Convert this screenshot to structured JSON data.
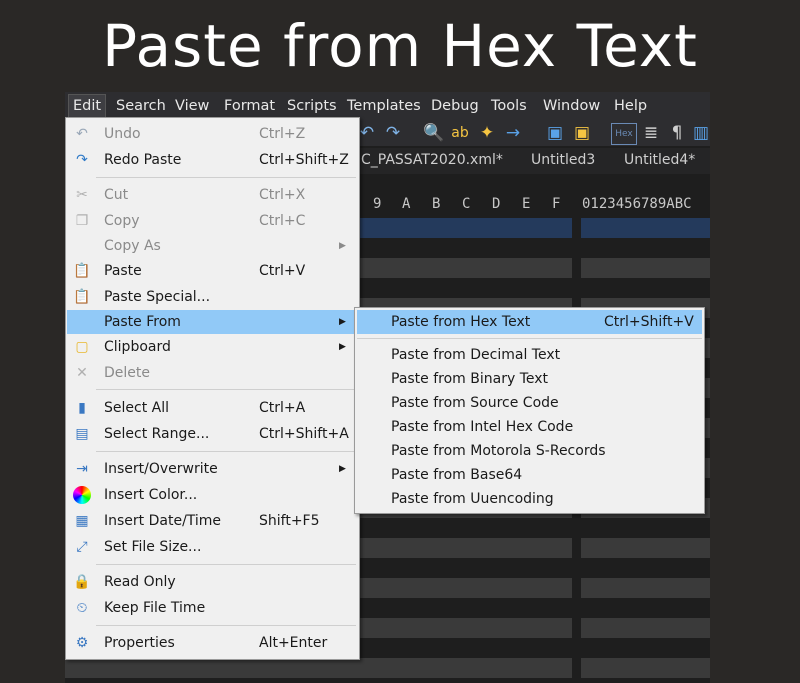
{
  "big_title": "Paste from Hex Text",
  "menubar": [
    "Edit",
    "Search",
    "View",
    "Format",
    "Scripts",
    "Templates",
    "Debug",
    "Tools",
    "Window",
    "Help"
  ],
  "tabs": [
    "C_PASSAT2020.xml*",
    "Untitled3",
    "Untitled4*"
  ],
  "hex_header": {
    "cols": [
      "9",
      "A",
      "B",
      "C",
      "D",
      "E",
      "F"
    ],
    "ascii": "0123456789ABC"
  },
  "edit_menu": {
    "undo": {
      "label": "Undo",
      "shortcut": "Ctrl+Z"
    },
    "redo": {
      "label": "Redo Paste",
      "shortcut": "Ctrl+Shift+Z"
    },
    "cut": {
      "label": "Cut",
      "shortcut": "Ctrl+X"
    },
    "copy": {
      "label": "Copy",
      "shortcut": "Ctrl+C"
    },
    "copy_as": {
      "label": "Copy As"
    },
    "paste": {
      "label": "Paste",
      "shortcut": "Ctrl+V"
    },
    "paste_special": {
      "label": "Paste Special..."
    },
    "paste_from": {
      "label": "Paste From"
    },
    "clipboard": {
      "label": "Clipboard"
    },
    "delete": {
      "label": "Delete"
    },
    "select_all": {
      "label": "Select All",
      "shortcut": "Ctrl+A"
    },
    "select_range": {
      "label": "Select Range...",
      "shortcut": "Ctrl+Shift+A"
    },
    "insert_overwrite": {
      "label": "Insert/Overwrite"
    },
    "insert_color": {
      "label": "Insert Color..."
    },
    "insert_datetime": {
      "label": "Insert Date/Time",
      "shortcut": "Shift+F5"
    },
    "set_file_size": {
      "label": "Set File Size..."
    },
    "read_only": {
      "label": "Read Only"
    },
    "keep_file_time": {
      "label": "Keep File Time"
    },
    "properties": {
      "label": "Properties",
      "shortcut": "Alt+Enter"
    }
  },
  "submenu": {
    "hex_text": {
      "label": "Paste from Hex Text",
      "shortcut": "Ctrl+Shift+V"
    },
    "decimal_text": {
      "label": "Paste from Decimal Text"
    },
    "binary_text": {
      "label": "Paste from Binary Text"
    },
    "source_code": {
      "label": "Paste from Source Code"
    },
    "intel_hex": {
      "label": "Paste from Intel Hex Code"
    },
    "motorola": {
      "label": "Paste from Motorola S-Records"
    },
    "base64": {
      "label": "Paste from Base64"
    },
    "uuencoding": {
      "label": "Paste from Uuencoding"
    }
  },
  "colors": {
    "highlight": "#91c9f7",
    "menu_bg": "#f0f0f0",
    "app_bg": "#2a2826"
  }
}
